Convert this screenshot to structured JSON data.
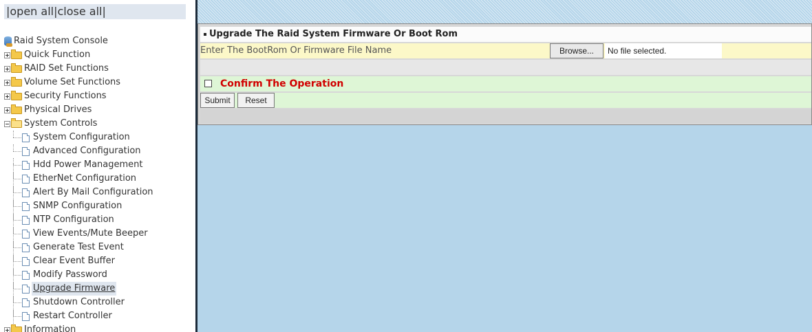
{
  "sidebar": {
    "open_all": "open all",
    "close_all": "close all",
    "separator": "|",
    "root_label": "Raid System Console",
    "folders": [
      {
        "label": "Quick Function"
      },
      {
        "label": "RAID Set Functions"
      },
      {
        "label": "Volume Set Functions"
      },
      {
        "label": "Security Functions"
      },
      {
        "label": "Physical Drives"
      },
      {
        "label": "System Controls"
      }
    ],
    "system_controls_items": [
      "System Configuration",
      "Advanced Configuration",
      "Hdd Power Management",
      "EtherNet Configuration",
      "Alert By Mail Configuration",
      "SNMP Configuration",
      "NTP Configuration",
      "View Events/Mute Beeper",
      "Generate Test Event",
      "Clear Event Buffer",
      "Modify Password",
      "Upgrade Firmware",
      "Shutdown Controller",
      "Restart Controller"
    ],
    "selected_item": "Upgrade Firmware",
    "last_folder": "Information"
  },
  "main": {
    "panel_title": "Upgrade The Raid System Firmware Or Boot Rom",
    "file_label": "Enter The BootRom Or Firmware File Name",
    "browse_label": "Browse...",
    "file_status": "No file selected.",
    "confirm_label": "Confirm The Operation",
    "confirm_checked": false,
    "submit_label": "Submit",
    "reset_label": "Reset"
  },
  "colors": {
    "main_bg": "#b5d5ea",
    "confirm_text": "#d10000",
    "file_row_bg": "#fcf8c8",
    "confirm_row_bg": "#def6d6"
  }
}
